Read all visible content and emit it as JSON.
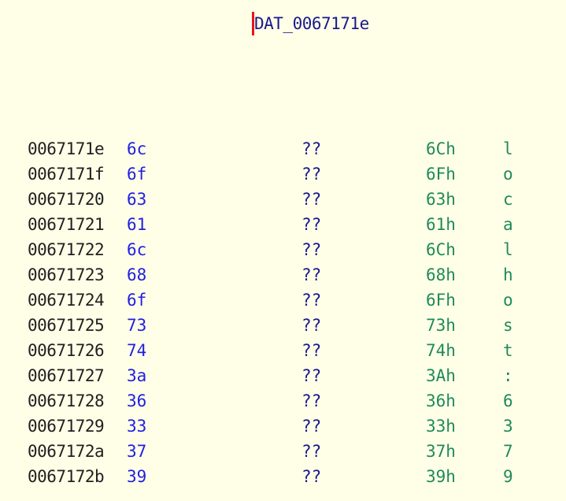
{
  "label": {
    "text": "DAT_0067171e"
  },
  "rows": [
    {
      "address": "0067171e",
      "byte": "6c",
      "mnemonic": "??",
      "hex": "6Ch",
      "char": "l"
    },
    {
      "address": "0067171f",
      "byte": "6f",
      "mnemonic": "??",
      "hex": "6Fh",
      "char": "o"
    },
    {
      "address": "00671720",
      "byte": "63",
      "mnemonic": "??",
      "hex": "63h",
      "char": "c"
    },
    {
      "address": "00671721",
      "byte": "61",
      "mnemonic": "??",
      "hex": "61h",
      "char": "a"
    },
    {
      "address": "00671722",
      "byte": "6c",
      "mnemonic": "??",
      "hex": "6Ch",
      "char": "l"
    },
    {
      "address": "00671723",
      "byte": "68",
      "mnemonic": "??",
      "hex": "68h",
      "char": "h"
    },
    {
      "address": "00671724",
      "byte": "6f",
      "mnemonic": "??",
      "hex": "6Fh",
      "char": "o"
    },
    {
      "address": "00671725",
      "byte": "73",
      "mnemonic": "??",
      "hex": "73h",
      "char": "s"
    },
    {
      "address": "00671726",
      "byte": "74",
      "mnemonic": "??",
      "hex": "74h",
      "char": "t"
    },
    {
      "address": "00671727",
      "byte": "3a",
      "mnemonic": "??",
      "hex": "3Ah",
      "char": ":"
    },
    {
      "address": "00671728",
      "byte": "36",
      "mnemonic": "??",
      "hex": "36h",
      "char": "6"
    },
    {
      "address": "00671729",
      "byte": "33",
      "mnemonic": "??",
      "hex": "33h",
      "char": "3"
    },
    {
      "address": "0067172a",
      "byte": "37",
      "mnemonic": "??",
      "hex": "37h",
      "char": "7"
    },
    {
      "address": "0067172b",
      "byte": "39",
      "mnemonic": "??",
      "hex": "39h",
      "char": "9"
    }
  ]
}
